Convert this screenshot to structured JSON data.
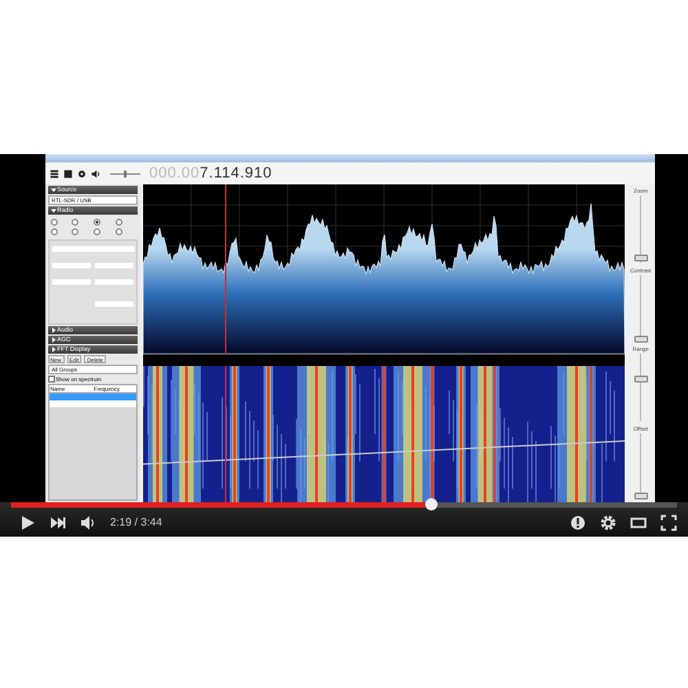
{
  "video": {
    "app": {
      "frequency_prefix": "000.00",
      "frequency": "7.114.910",
      "sections": [
        {
          "label": "Source",
          "expanded": true
        },
        {
          "label": "Radio",
          "expanded": true
        },
        {
          "label": "Audio",
          "expanded": false
        },
        {
          "label": "AGC",
          "expanded": false
        },
        {
          "label": "FFT Display",
          "expanded": false
        }
      ],
      "source_select": "RTL-SDR / USB",
      "tuning": {
        "level": 0.5
      },
      "modes": [
        {
          "selected": false
        },
        {
          "selected": false
        },
        {
          "selected": true
        },
        {
          "selected": false
        },
        {
          "selected": false
        },
        {
          "selected": false
        },
        {
          "selected": false
        },
        {
          "selected": false
        }
      ],
      "manager": {
        "buttons": [
          "New",
          "Edit",
          "Delete"
        ],
        "group_select": "All Groups",
        "show_on_spectrum": {
          "label": "Show on spectrum",
          "checked": false
        },
        "columns": [
          "Name",
          "Frequency"
        ],
        "rows": [
          {
            "selected": true
          },
          {
            "selected": false
          }
        ]
      },
      "sliders": [
        {
          "label": "Zoom",
          "level": 0.05
        },
        {
          "label": "Contrast",
          "level": 0.03
        },
        {
          "label": "Range",
          "level": 0.6
        },
        {
          "label": "Offset",
          "level": 0.05
        }
      ]
    }
  },
  "player": {
    "progress": {
      "level": 0.63
    },
    "time": "2:19 / 3:44"
  }
}
